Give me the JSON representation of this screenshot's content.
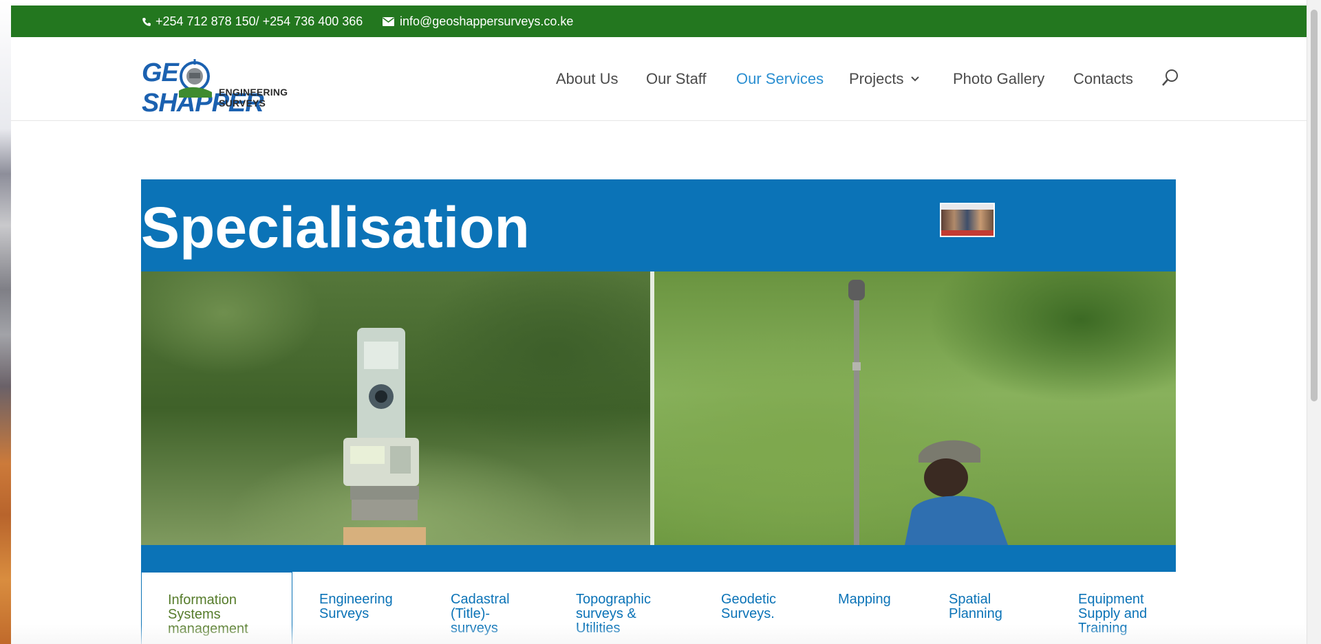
{
  "topbar": {
    "phone": "+254 712 878 150/ +254 736 400 366",
    "email": "info@geoshappersurveys.co.ke",
    "bg_color": "#23771f"
  },
  "logo": {
    "main_left": "GE",
    "main_right": "SHAPPER",
    "sub": "ENGINEERING SURVEYS"
  },
  "nav": {
    "items": [
      {
        "label": "About Us"
      },
      {
        "label": "Our Staff"
      },
      {
        "label": "Our Services",
        "active": true
      },
      {
        "label": "Projects",
        "has_dropdown": true
      },
      {
        "label": "Photo Gallery"
      },
      {
        "label": "Contacts"
      }
    ],
    "active_color": "#2b8fd1"
  },
  "hero": {
    "title": "Specialisation",
    "bg_color": "#0b73b7"
  },
  "tabs": [
    {
      "label": "Information Systems management",
      "active": true
    },
    {
      "label": "Engineering Surveys"
    },
    {
      "label": "Cadastral (Title)-surveys"
    },
    {
      "label": "Topographic surveys & Utilities"
    },
    {
      "label": "Geodetic Surveys."
    },
    {
      "label": "Mapping"
    },
    {
      "label": "Spatial Planning"
    },
    {
      "label": "Equipment Supply and Training"
    }
  ]
}
